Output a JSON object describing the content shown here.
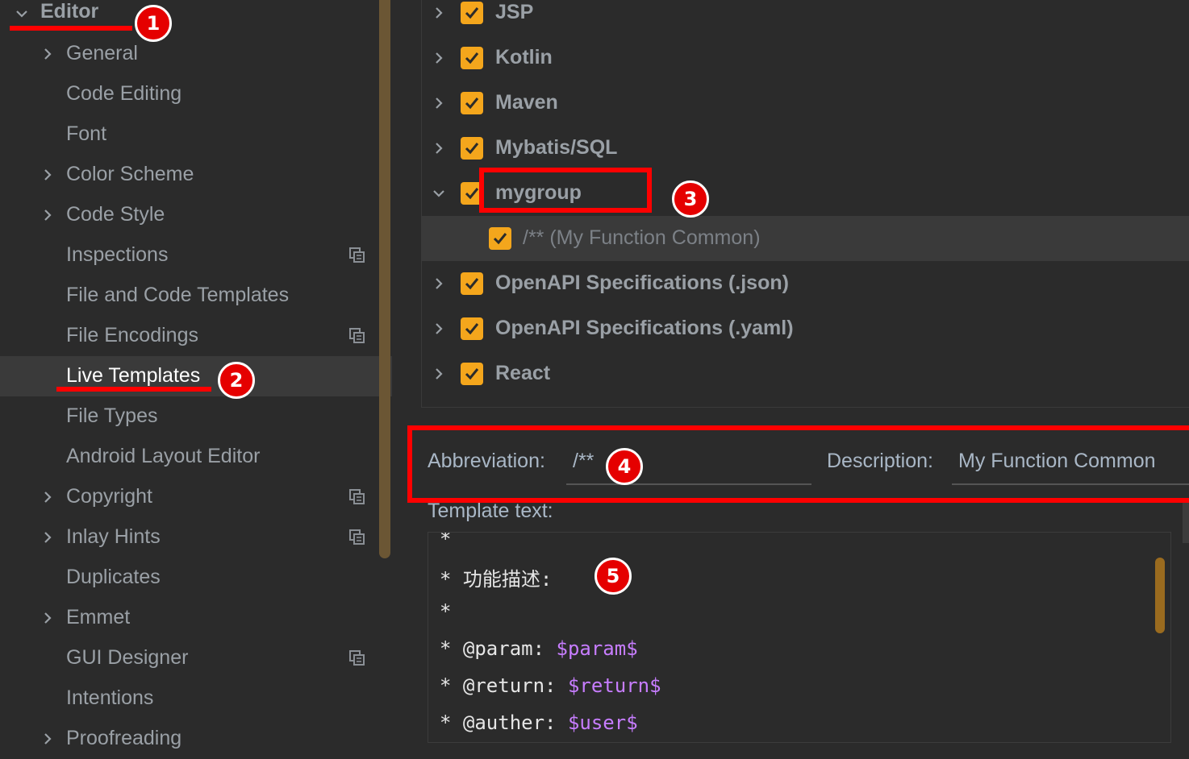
{
  "sidebar": {
    "editor_label": "Editor",
    "items": [
      {
        "label": "General",
        "expandable": true,
        "project_icon": false
      },
      {
        "label": "Code Editing",
        "expandable": false,
        "project_icon": false
      },
      {
        "label": "Font",
        "expandable": false,
        "project_icon": false
      },
      {
        "label": "Color Scheme",
        "expandable": true,
        "project_icon": false
      },
      {
        "label": "Code Style",
        "expandable": true,
        "project_icon": false
      },
      {
        "label": "Inspections",
        "expandable": false,
        "project_icon": true
      },
      {
        "label": "File and Code Templates",
        "expandable": false,
        "project_icon": false
      },
      {
        "label": "File Encodings",
        "expandable": false,
        "project_icon": true
      },
      {
        "label": "Live Templates",
        "expandable": false,
        "project_icon": false,
        "selected": true
      },
      {
        "label": "File Types",
        "expandable": false,
        "project_icon": false
      },
      {
        "label": "Android Layout Editor",
        "expandable": false,
        "project_icon": false
      },
      {
        "label": "Copyright",
        "expandable": true,
        "project_icon": true
      },
      {
        "label": "Inlay Hints",
        "expandable": true,
        "project_icon": true
      },
      {
        "label": "Duplicates",
        "expandable": false,
        "project_icon": false
      },
      {
        "label": "Emmet",
        "expandable": true,
        "project_icon": false
      },
      {
        "label": "GUI Designer",
        "expandable": false,
        "project_icon": true
      },
      {
        "label": "Intentions",
        "expandable": false,
        "project_icon": false
      },
      {
        "label": "Proofreading",
        "expandable": true,
        "project_icon": false
      }
    ]
  },
  "template_tree": {
    "groups": [
      {
        "label": "JSP",
        "checked": true,
        "expanded": false
      },
      {
        "label": "Kotlin",
        "checked": true,
        "expanded": false
      },
      {
        "label": "Maven",
        "checked": true,
        "expanded": false
      },
      {
        "label": "Mybatis/SQL",
        "checked": true,
        "expanded": false
      },
      {
        "label": "mygroup",
        "checked": true,
        "expanded": true
      },
      {
        "label": "/** (My Function Common)",
        "checked": true,
        "child": true,
        "selected": true
      },
      {
        "label": "OpenAPI Specifications (.json)",
        "checked": true,
        "expanded": false
      },
      {
        "label": "OpenAPI Specifications (.yaml)",
        "checked": true,
        "expanded": false
      },
      {
        "label": "React",
        "checked": true,
        "expanded": false
      }
    ]
  },
  "form": {
    "abbreviation_label": "Abbreviation:",
    "abbreviation_value": "/**",
    "description_label": "Description:",
    "description_value": "My Function Common",
    "template_text_label": "Template text:"
  },
  "template_text": {
    "lines": [
      {
        "prefix": "*",
        "var": ""
      },
      {
        "prefix": "* 功能描述:",
        "var": ""
      },
      {
        "prefix": "*",
        "var": ""
      },
      {
        "prefix": "* @param: ",
        "var": "$param$"
      },
      {
        "prefix": "* @return: ",
        "var": "$return$"
      },
      {
        "prefix": "* @auther: ",
        "var": "$user$"
      }
    ]
  },
  "annotations": {
    "badges": [
      "1",
      "2",
      "3",
      "4",
      "5"
    ],
    "color": "#ff0000"
  },
  "colors": {
    "background": "#2b2b2b",
    "checkbox": "#f4a61c",
    "variable": "#c77dff",
    "selection": "#3a3a3a"
  }
}
